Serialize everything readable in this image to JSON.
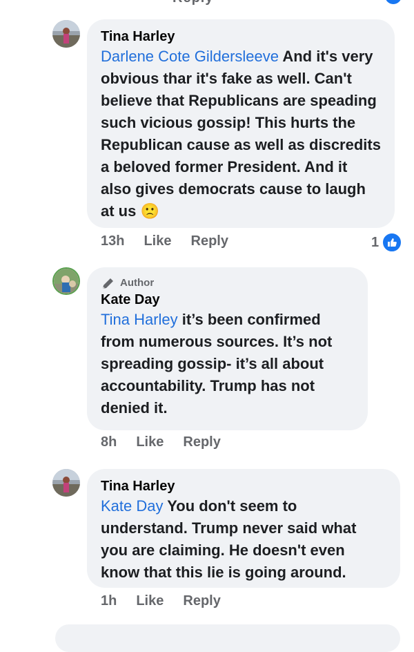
{
  "top_fragment": "Reply",
  "comments": [
    {
      "author": "Tina Harley",
      "mention": "Darlene Cote Gildersleeve",
      "text": " And it's very obvious thar it's fake as well. Can't believe that Republicans are speading such vicious gossip!  This hurts the Republican cause as well as discredits a beloved former President.  And it also gives democrats cause to laugh at us ",
      "emoji": "🙁",
      "time": "13h",
      "like_label": "Like",
      "reply_label": "Reply",
      "reaction_count": "1",
      "reaction_icon": "thumbs-up-icon"
    },
    {
      "badge": "Author",
      "author": "Kate Day",
      "mention": "Tina Harley",
      "text": " it’s been confirmed from numerous sources. It’s not spreading gossip- it’s all about accountability. Trump has not denied it.",
      "time": "8h",
      "like_label": "Like",
      "reply_label": "Reply"
    },
    {
      "author": "Tina Harley",
      "mention": "Kate Day",
      "text": " You don't seem to understand.  Trump never said what you are claiming.  He doesn't even know that this lie is going around.",
      "time": "1h",
      "like_label": "Like",
      "reply_label": "Reply"
    }
  ],
  "colors": {
    "bubble": "#f0f2f5",
    "mention": "#216fdb",
    "meta": "#65676b",
    "like_blue": "#1877f2"
  }
}
